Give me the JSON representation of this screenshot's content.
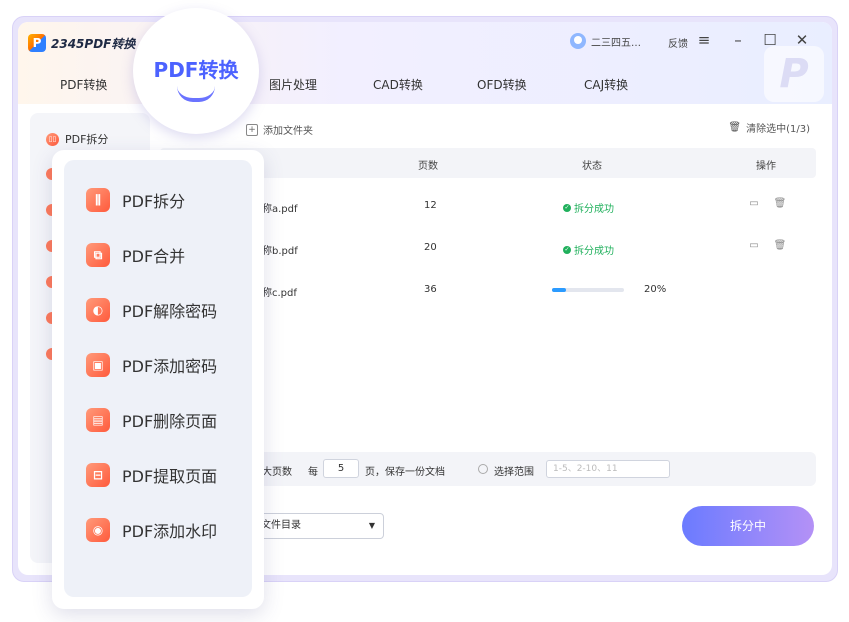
{
  "app": {
    "name": "2345PDF转换"
  },
  "user": {
    "name": "二三四五…"
  },
  "header": {
    "feedback": "反馈"
  },
  "tabs": [
    {
      "label": "PDF转换"
    },
    {
      "label": "图片处理"
    },
    {
      "label": "CAD转换"
    },
    {
      "label": "OFD转换"
    },
    {
      "label": "CAJ转换"
    }
  ],
  "badge": {
    "title": "PDF转换"
  },
  "sidebar": {
    "first_item": "PDF拆分"
  },
  "toolbar": {
    "add_folder": "添加文件夹",
    "clear_selected": "清除选中(1/3)"
  },
  "table": {
    "headers": {
      "pages": "页数",
      "status": "状态",
      "action": "操作"
    },
    "rows": [
      {
        "name": "称a.pdf",
        "pages": "12",
        "status": "拆分成功"
      },
      {
        "name": "称b.pdf",
        "pages": "20",
        "status": "拆分成功"
      },
      {
        "name": "称c.pdf",
        "pages": "36",
        "progress_label": "20%",
        "progress": 0.2
      }
    ]
  },
  "options": {
    "max_pages_label": "大页数",
    "every_label": "每",
    "every_value": "5",
    "every_suffix": "页，保存一份文档",
    "range_label": "选择范围",
    "range_placeholder": "1-5、2-10、11"
  },
  "output": {
    "dir_label": "文件目录"
  },
  "actions": {
    "split": "拆分中"
  },
  "popup": {
    "items": [
      {
        "label": "PDF拆分",
        "icon": "split-icon"
      },
      {
        "label": "PDF合并",
        "icon": "merge-icon"
      },
      {
        "label": "PDF解除密码",
        "icon": "unlock-icon"
      },
      {
        "label": "PDF添加密码",
        "icon": "lock-icon"
      },
      {
        "label": "PDF删除页面",
        "icon": "delete-page-icon"
      },
      {
        "label": "PDF提取页面",
        "icon": "extract-page-icon"
      },
      {
        "label": "PDF添加水印",
        "icon": "watermark-icon"
      }
    ]
  },
  "colors": {
    "accent": "#4c62ff",
    "success": "#20b05c",
    "progress": "#2b9bff",
    "button_from": "#6b7bff",
    "button_to": "#b491f6"
  }
}
